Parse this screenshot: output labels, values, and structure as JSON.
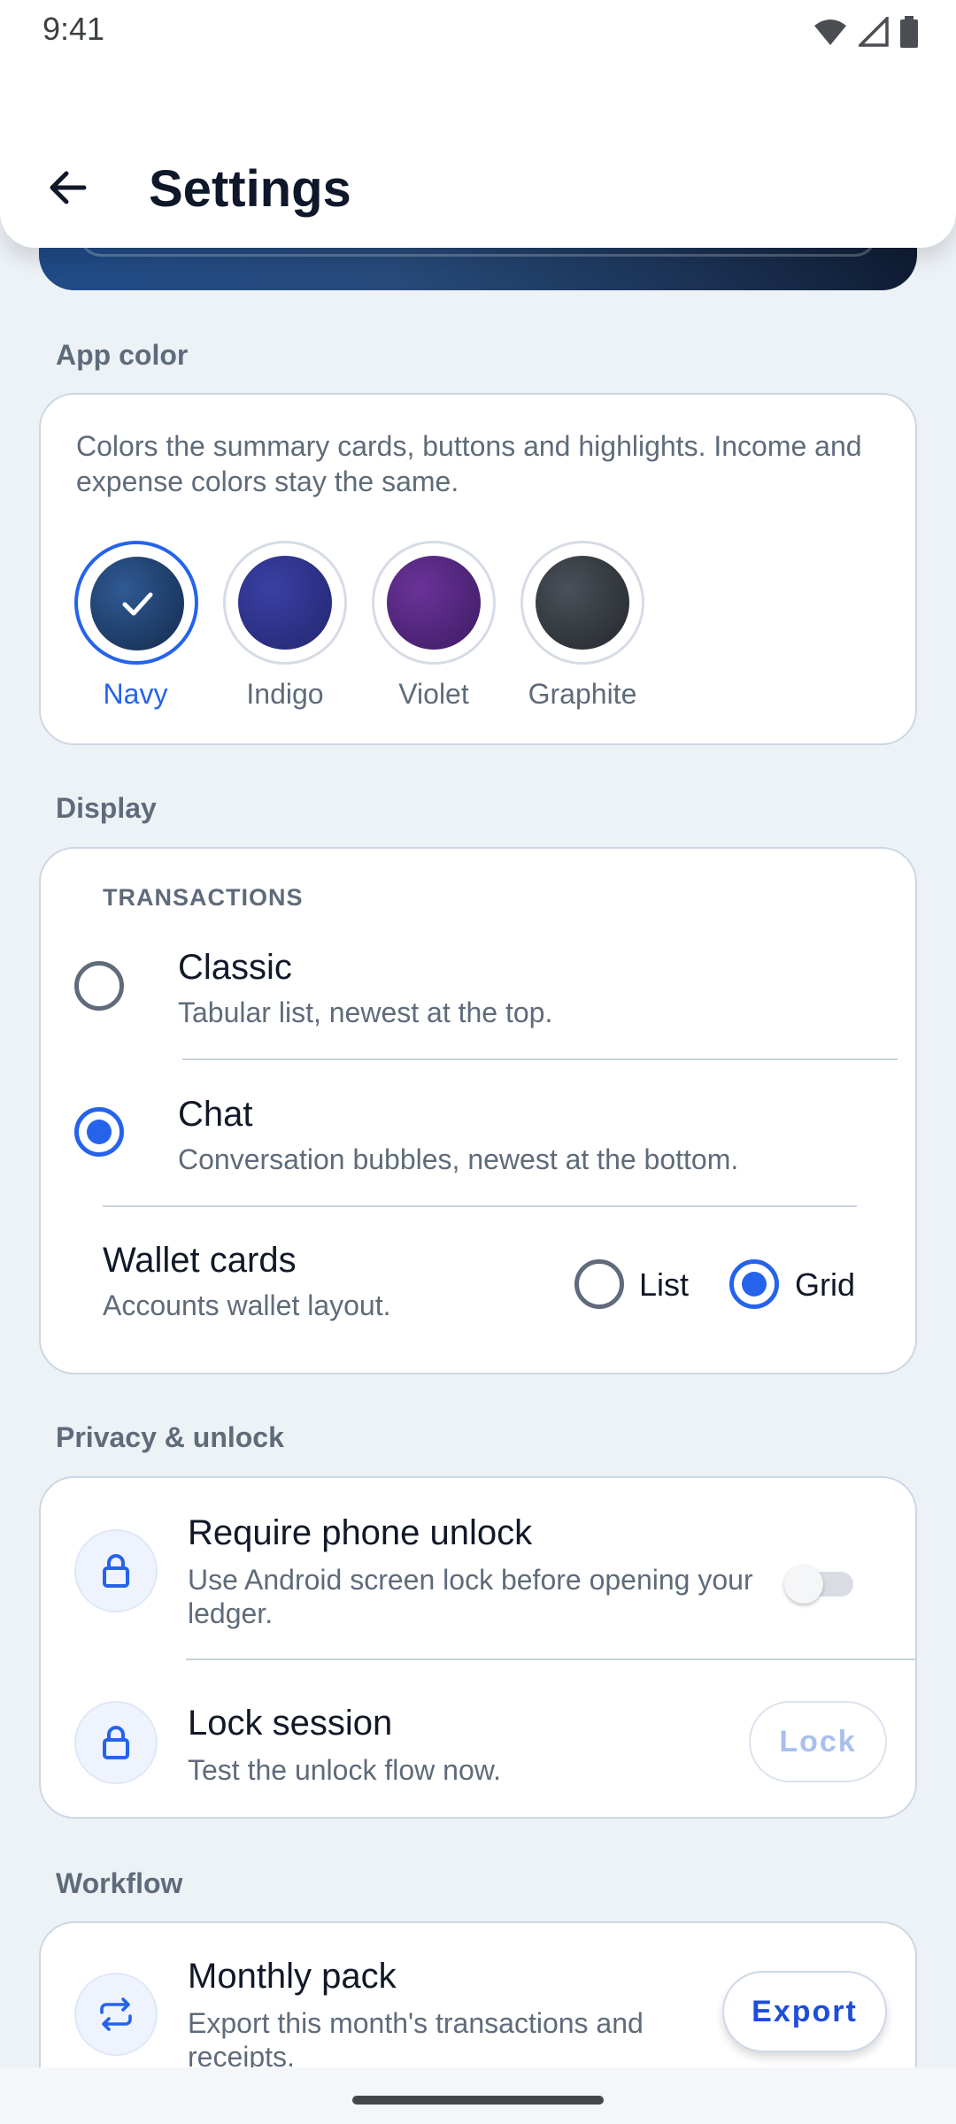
{
  "status_bar": {
    "time": "9:41"
  },
  "header": {
    "title": "Settings"
  },
  "app_color": {
    "section_title": "App color",
    "description": "Colors the summary cards, buttons and highlights. Income and expense colors stay the same.",
    "swatches": [
      {
        "name": "Navy",
        "color": "#1d3b66",
        "selected": true
      },
      {
        "name": "Indigo",
        "color": "#2a2f82",
        "selected": false
      },
      {
        "name": "Violet",
        "color": "#4c2376",
        "selected": false
      },
      {
        "name": "Graphite",
        "color": "#33373d",
        "selected": false
      }
    ],
    "accent_color": "#2563eb"
  },
  "display": {
    "section_title": "Display",
    "overline": "TRANSACTIONS",
    "options": [
      {
        "title": "Classic",
        "subtitle": "Tabular list, newest at the top.",
        "selected": false
      },
      {
        "title": "Chat",
        "subtitle": "Conversation bubbles, newest at the bottom.",
        "selected": true
      }
    ],
    "wallet": {
      "title": "Wallet cards",
      "subtitle": "Accounts wallet layout.",
      "options": [
        "List",
        "Grid"
      ],
      "selected": "Grid"
    }
  },
  "privacy": {
    "section_title": "Privacy & unlock",
    "require_unlock": {
      "title": "Require phone unlock",
      "subtitle": "Use Android screen lock before opening your ledger.",
      "enabled": false
    },
    "lock_session": {
      "title": "Lock session",
      "subtitle": "Test the unlock flow now.",
      "button": "Lock"
    }
  },
  "workflow": {
    "section_title": "Workflow",
    "monthly_pack": {
      "title": "Monthly pack",
      "subtitle": "Export this month's transactions and receipts.",
      "button": "Export"
    }
  }
}
